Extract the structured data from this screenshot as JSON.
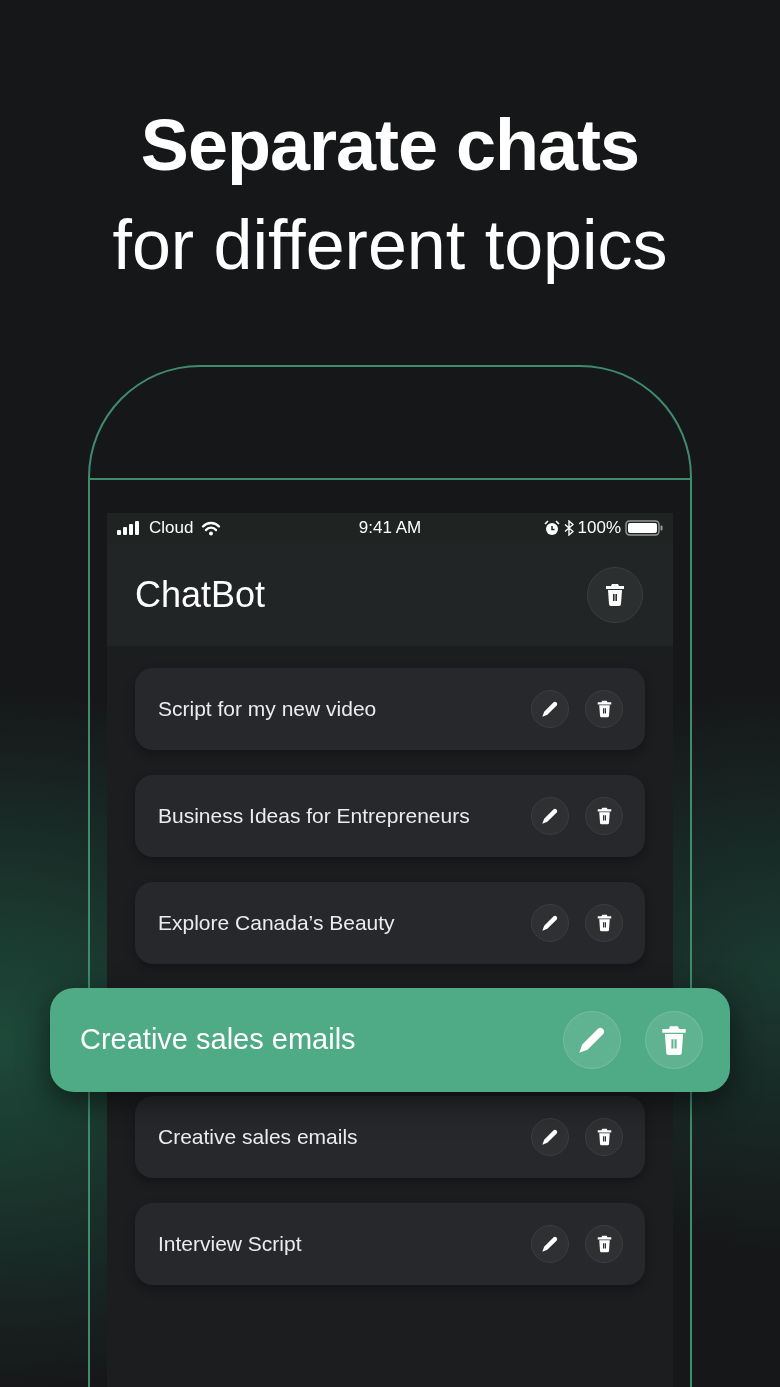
{
  "headline": {
    "line_1": "Separate chats",
    "line_2": "for different topics"
  },
  "status_bar": {
    "carrier": "Cloud",
    "time": "9:41 AM",
    "battery": "100%"
  },
  "app": {
    "title": "ChatBot"
  },
  "chats": [
    {
      "kind": "chat",
      "title": "Script for my new video"
    },
    {
      "kind": "chat",
      "title": "Business Ideas for Entrepreneurs"
    },
    {
      "kind": "chat",
      "title": "Explore Canada’s Beauty"
    },
    {
      "kind": "gap"
    },
    {
      "kind": "chat",
      "title": "Creative sales emails"
    },
    {
      "kind": "chat",
      "title": "Interview Script"
    }
  ],
  "dragged_chat": {
    "title": "Creative sales emails"
  }
}
